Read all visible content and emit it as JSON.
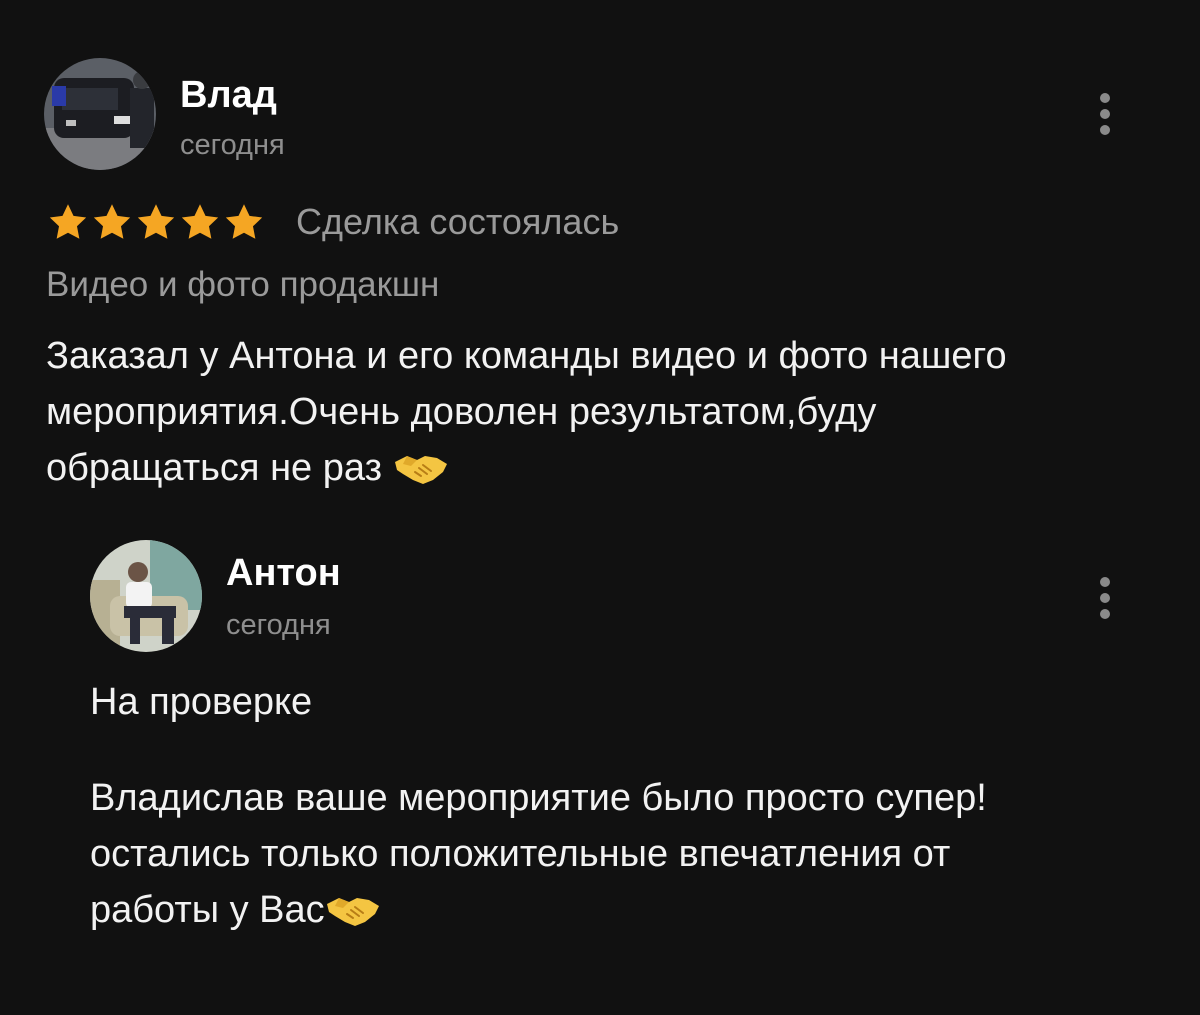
{
  "review": {
    "author": "Влад",
    "date": "сегодня",
    "rating": 5,
    "rating_max": 5,
    "deal_status": "Сделка состоялась",
    "category": "Видео и фото продакшн",
    "body_lines": [
      "Заказал у Антона и его команды видео и фото нашего",
      "мероприятия.Очень доволен результатом,буду",
      "обращаться не раз"
    ]
  },
  "reply": {
    "author": "Антон",
    "date": "сегодня",
    "status": "На проверке",
    "body_lines": [
      "Владислав ваше мероприятие было просто супер!",
      "остались только положительные впечатления от",
      "работы у Вас"
    ]
  },
  "icons": {
    "star_color": "#f5a623",
    "handshake_color": "#f4c542",
    "more": "more-vertical-icon"
  }
}
